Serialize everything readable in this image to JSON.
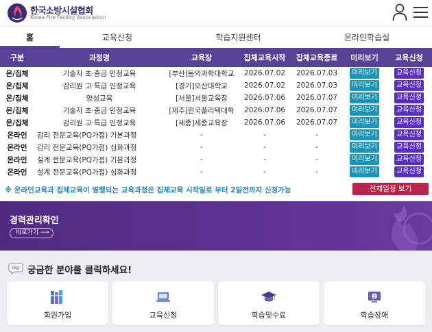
{
  "header": {
    "org_name": "한국소방시설협회",
    "org_sub": "Korea Fire Facility Association"
  },
  "tabs": [
    {
      "label": "홈"
    },
    {
      "label": "교육신청"
    },
    {
      "label": "학습지원센터"
    },
    {
      "label": "온라인학습실"
    }
  ],
  "table": {
    "headers": [
      "구분",
      "과정명",
      "교육장",
      "집체교육시작",
      "집체교육종료",
      "미리보기",
      "교육신청"
    ],
    "rows": [
      {
        "kind": "온/집체",
        "course": "기술자 초·중급 인정교육",
        "place": "[부산]동의과학대학교",
        "start": "2026.07.02",
        "end": "2026.07.03",
        "preview": "미리보기",
        "apply": "교육신청"
      },
      {
        "kind": "온/집체",
        "course": "감리원 고·특급 인정교육",
        "place": "[경기]오산대학교",
        "start": "2026.07.02",
        "end": "2026.07.03",
        "preview": "미리보기",
        "apply": "교육신청"
      },
      {
        "kind": "온/집체",
        "course": "양성교육",
        "place": "[서울]서울교육장",
        "start": "2026.07.06",
        "end": "2026.07.07",
        "preview": "미리보기",
        "apply": "교육신청"
      },
      {
        "kind": "온/집체",
        "course": "기술자 초·중급 인정교육",
        "place": "[제주]한국폴리텍대학",
        "start": "2026.07.06",
        "end": "2026.07.07",
        "preview": "미리보기",
        "apply": "교육신청"
      },
      {
        "kind": "온/집체",
        "course": "감리원 고·특급 인정교육",
        "place": "[세종]세종교육장",
        "start": "2026.07.06",
        "end": "2026.07.07",
        "preview": "미리보기",
        "apply": "교육신청"
      },
      {
        "kind": "온라인",
        "course": "감리 전문교육(PQ가점) 기본과정",
        "place": "-",
        "start": "-",
        "end": "-",
        "preview": "미리보기",
        "apply": "교육신청"
      },
      {
        "kind": "온라인",
        "course": "감리 전문교육(PQ가점) 심화과정",
        "place": "-",
        "start": "-",
        "end": "-",
        "preview": "미리보기",
        "apply": "교육신청"
      },
      {
        "kind": "온라인",
        "course": "설계 전문교육(PQ가점) 기본과정",
        "place": "-",
        "start": "-",
        "end": "-",
        "preview": "미리보기",
        "apply": "교육신청"
      },
      {
        "kind": "온라인",
        "course": "설계 전문교육(PQ가점) 심화과정",
        "place": "-",
        "start": "-",
        "end": "-",
        "preview": "미리보기",
        "apply": "교육신청"
      }
    ]
  },
  "notice": "※ 온라인교육과 집체교육이 병행되는 교육과정은 집체교육 시작일로 부터 2일전까지 신청가능",
  "full_schedule_button": "전체일정 보기",
  "banner": {
    "title": "경력관리확인",
    "link": "바로가기 ⟶"
  },
  "faq": {
    "icon_text": "FAQ",
    "title": "궁금한 분야를 클릭하세요!",
    "cards": [
      {
        "label": "회원가입",
        "icon": "books-icon"
      },
      {
        "label": "교육신청",
        "icon": "laptop-icon"
      },
      {
        "label": "학습및수료",
        "icon": "graduation-cap-icon"
      },
      {
        "label": "학습장애",
        "icon": "monitor-alert-icon"
      }
    ]
  },
  "colors": {
    "primary": "#574196",
    "preview_button": "#1c93b8",
    "apply_button": "#5a2ec2",
    "schedule_button": "#b8234e",
    "notice_text": "#1f88b5"
  }
}
